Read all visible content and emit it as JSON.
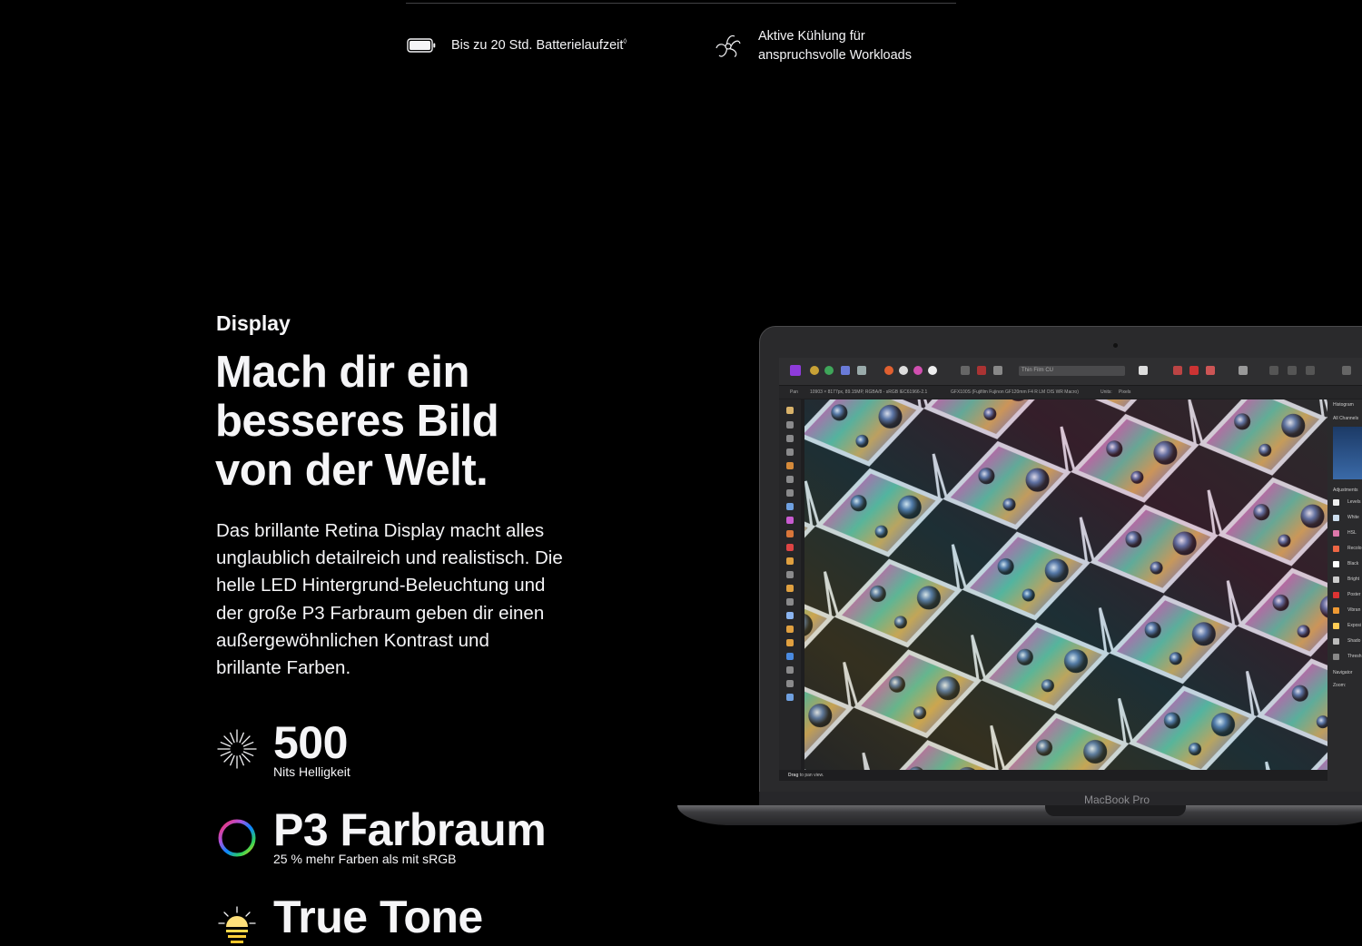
{
  "features": {
    "battery": {
      "text": "Bis zu 20 Std. Batterielaufzeit",
      "footnote": "◊",
      "icon": "battery-icon"
    },
    "cooling": {
      "line1": "Aktive Kühlung für",
      "line2": "anspruchsvolle Workloads",
      "icon": "fan-icon"
    }
  },
  "display_section": {
    "eyebrow": "Display",
    "headline_lines": [
      "Mach dir ein",
      "besseres Bild",
      "von der Welt."
    ],
    "body_lines": [
      "Das brillante Retina Display macht alles",
      "unglaublich detailreich und realistisch. Die",
      "helle LED Hintergrund-Beleuchtung und",
      "der große P3 Farbraum geben dir einen",
      "außergewöhnlichen Kontrast und",
      "brillante Farben."
    ],
    "stats": [
      {
        "value": "500",
        "caption": "Nits Helligkeit",
        "icon": "brightness-icon"
      },
      {
        "value": "P3 Farbraum",
        "caption": "25 % mehr Farben als mit sRGB",
        "icon": "color-ring-icon"
      },
      {
        "value": "True Tone",
        "caption": "",
        "icon": "true-tone-icon"
      }
    ]
  },
  "laptop": {
    "model_label": "MacBook Pro",
    "app": {
      "field_text": "Thin Film CU",
      "tool_label": "Pan",
      "doc_info": "10903 × 8177px, 89.15MP, RGBA/8 - sRGB IEC61966-2.1",
      "lens_info": "GFX100S (Fujifilm Fujinon GF120mm F4 R LM OIS WR Macro)",
      "units_label": "Units:",
      "units_value": "Pixels",
      "panel_title": "Histogram",
      "panel_channels": "All Channels",
      "adjustments_title": "Adjustments",
      "adjustments": [
        "Levels",
        "White",
        "HSL",
        "Recolo",
        "Black",
        "Bright",
        "Poster",
        "Vibran",
        "Exposi",
        "Shado",
        "Thresh"
      ],
      "navigator_title": "Navigator",
      "zoom_label": "Zoom:",
      "status_bold": "Drag",
      "status_text": "to pan view."
    }
  },
  "colors": {
    "background": "#000000",
    "text": "#f5f5f7",
    "divider": "#424245"
  }
}
